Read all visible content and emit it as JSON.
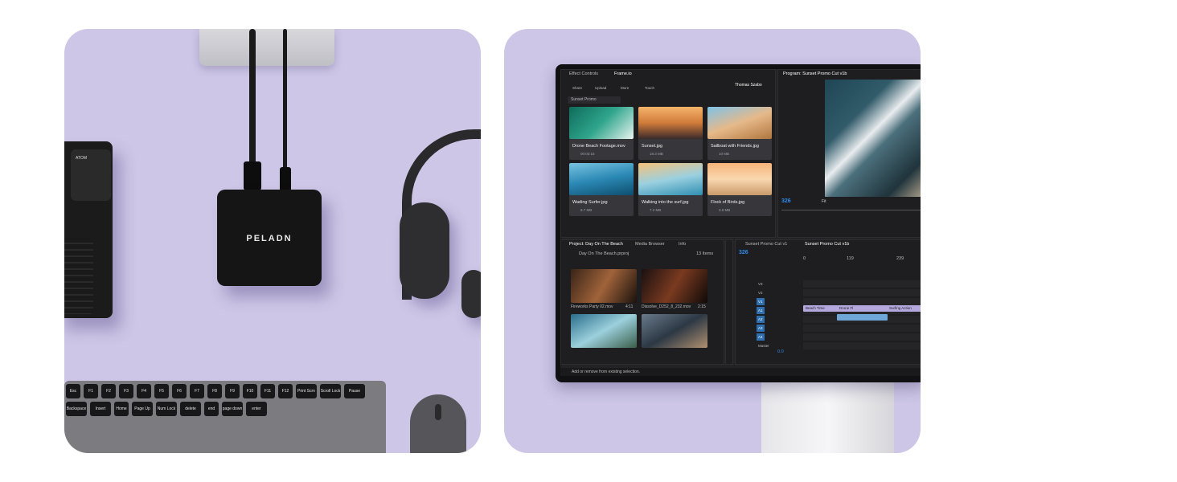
{
  "colors": {
    "background": "#ffffff",
    "card": "#cdc6e6",
    "accent": "#2d8ceb"
  },
  "left_scene": {
    "hub_brand": "PELADN",
    "camera_label": "ATOM",
    "keyboard_keys": [
      "Esc",
      "F1",
      "F2",
      "F3",
      "F4",
      "F5",
      "F6",
      "F7",
      "F8",
      "F9",
      "F10",
      "F11",
      "F12",
      "Print Scrn",
      "Scroll Lock",
      "Pause",
      "Backspace",
      "Insert",
      "Home",
      "Page Up",
      "Num Lock",
      "delete",
      "end",
      "page down",
      "enter"
    ]
  },
  "editor": {
    "top_tabs": [
      "Effect Controls",
      "Frame.io"
    ],
    "toolbar": [
      "Share",
      "Upload",
      "More",
      "Touch"
    ],
    "user_name": "Thomas Szabo",
    "project_dropdown": "Sunset Promo",
    "media_tiles": [
      {
        "name": "Drone Beach Footage.mov",
        "meta": "00:03:15"
      },
      {
        "name": "Sunset.jpg",
        "meta": "18.3 MB"
      },
      {
        "name": "Sailboat with Friends.jpg",
        "meta": "10 MB"
      },
      {
        "name": "Wading Surfer.jpg",
        "meta": "8.7 MB"
      },
      {
        "name": "Walking into the surf.jpg",
        "meta": "7.2 MB"
      },
      {
        "name": "Flock of Birds.jpg",
        "meta": "3.9 MB"
      }
    ],
    "program_title": "Program: Sunset Promo Cut v1b",
    "program_timecode": "326",
    "program_fit": "Fit",
    "project_panel": {
      "tabs": [
        "Project: Day On The Beach",
        "Media Browser",
        "Info"
      ],
      "file": "Day On The Beach.prproj",
      "items": "13 Items",
      "clips": [
        {
          "name": "Fireworks Party 02.mov",
          "dur": "4:11"
        },
        {
          "name": "Dissolve_D252_8_232.mov",
          "dur": "2:15"
        }
      ]
    },
    "timeline": {
      "tabs": [
        "Sunset Promo Cut v1",
        "Sunset Promo Cut v1b"
      ],
      "timecode": "326",
      "ruler": [
        "0",
        "119",
        "239"
      ],
      "tracks": [
        "V3",
        "V2",
        "V1",
        "A1",
        "A2",
        "A3",
        "A4",
        "Master"
      ],
      "master_value": "0.0",
      "clips": [
        "Beach Time",
        "Drone Fl",
        "Surfing Action"
      ]
    },
    "status_text": "Add or remove from existing selection."
  }
}
